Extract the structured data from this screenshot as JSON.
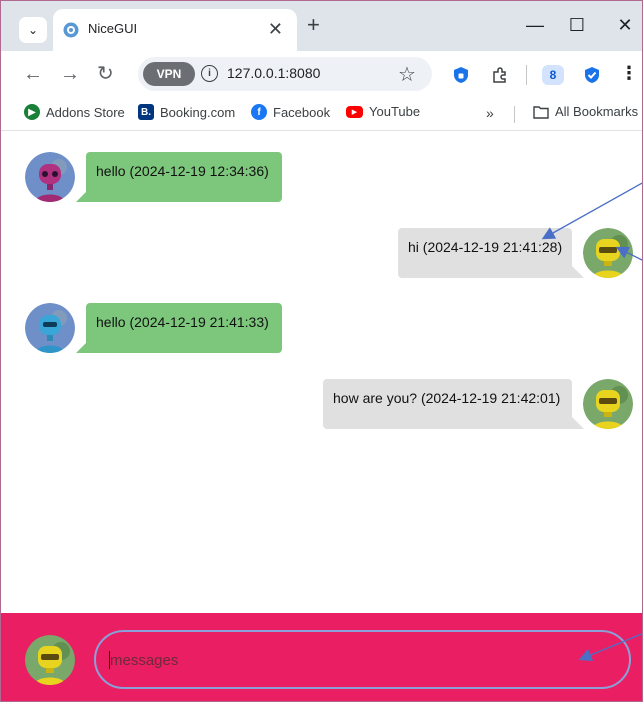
{
  "browser": {
    "tab_title": "NiceGUI",
    "url": "127.0.0.1:8080",
    "vpn_label": "VPN",
    "profile_initial": "8",
    "new_tab_symbol": "+",
    "close_tab_symbol": "✕",
    "minimize_symbol": "—",
    "maximize_symbol": "☐",
    "close_window_symbol": "✕",
    "more_symbol": "⋮"
  },
  "bookmarks": {
    "items": [
      {
        "label": "Addons Store",
        "icon": "addons-store-icon",
        "color": "#188038"
      },
      {
        "label": "Booking.com",
        "icon": "booking-icon",
        "color": "#003580"
      },
      {
        "label": "Facebook",
        "icon": "facebook-icon",
        "color": "#1877f2"
      },
      {
        "label": "YouTube",
        "icon": "youtube-icon",
        "color": "#ff0000"
      }
    ],
    "overflow_symbol": "»",
    "all_bookmarks_label": "All Bookmarks"
  },
  "chat": {
    "messages": [
      {
        "text": "hello (2024-12-19 12:34:36)",
        "side": "received",
        "avatar": "purple-robot"
      },
      {
        "text": "hi (2024-12-19 21:41:28)",
        "side": "sent",
        "avatar": "yellow-robot"
      },
      {
        "text": "hello (2024-12-19 21:41:33)",
        "side": "received",
        "avatar": "blue-robot"
      },
      {
        "text": "how are you? (2024-12-19 21:42:01)",
        "side": "sent",
        "avatar": "yellow-robot"
      }
    ],
    "input_placeholder": "messages"
  },
  "colors": {
    "received_bubble": "#7dc77d",
    "sent_bubble": "#e0e0e0",
    "footer": "#ea1f63",
    "annotation_arrow": "#4a6fc7"
  }
}
